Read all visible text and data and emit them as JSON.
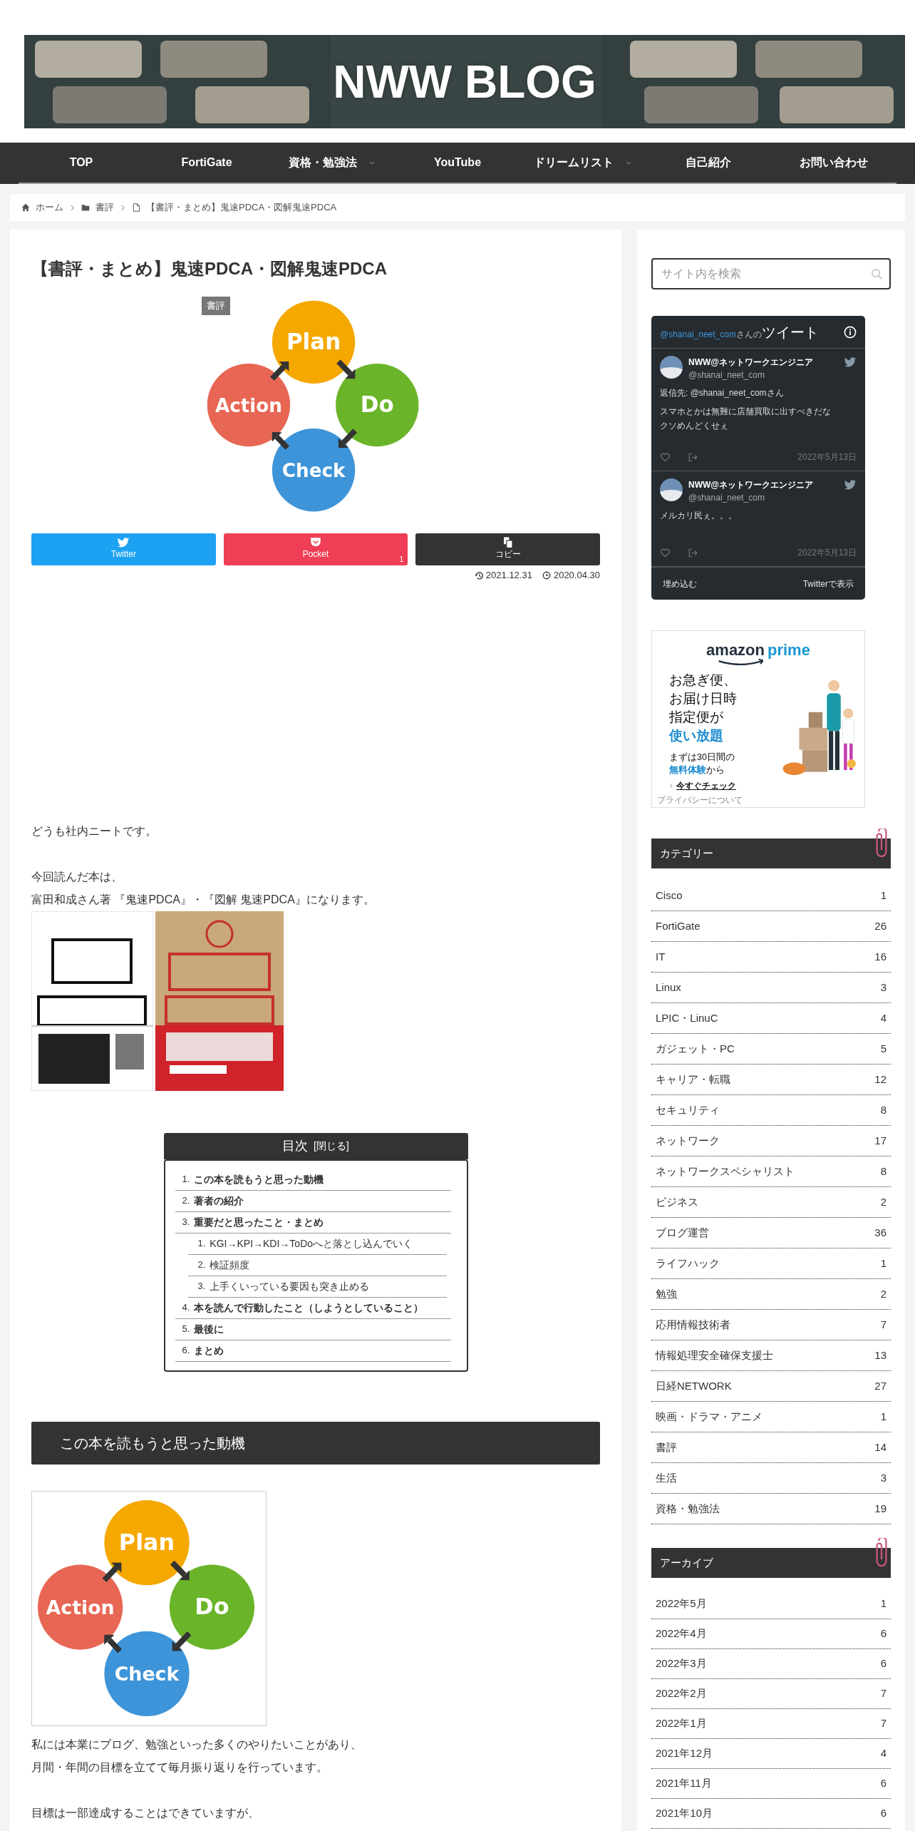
{
  "header": {
    "title": "NWW BLOG"
  },
  "nav": [
    {
      "label": "TOP",
      "submenu": false
    },
    {
      "label": "FortiGate",
      "submenu": false
    },
    {
      "label": "資格・勉強法",
      "submenu": true
    },
    {
      "label": "YouTube",
      "submenu": false
    },
    {
      "label": "ドリームリスト",
      "submenu": true
    },
    {
      "label": "自己紹介",
      "submenu": false
    },
    {
      "label": "お問い合わせ",
      "submenu": false
    }
  ],
  "breadcrumb": [
    {
      "kind": "home",
      "label": "ホーム"
    },
    {
      "kind": "category",
      "label": "書評"
    },
    {
      "kind": "page",
      "label": "【書評・まとめ】鬼速PDCA・図解鬼速PDCA"
    }
  ],
  "article": {
    "title": "【書評・まとめ】鬼速PDCA・図解鬼速PDCA",
    "category_label": "書評",
    "eyecatch": {
      "labels": [
        "Plan",
        "Do",
        "Check",
        "Action"
      ]
    },
    "share_buttons": [
      {
        "kind": "twitter",
        "label": "Twitter"
      },
      {
        "kind": "pocket",
        "label": "Pocket",
        "count": "1"
      },
      {
        "kind": "copy",
        "label": "コピー"
      }
    ],
    "dates": [
      {
        "kind": "updated",
        "text": "2021.12.31"
      },
      {
        "kind": "published",
        "text": "2020.04.30"
      }
    ],
    "blocks": [
      {
        "kind": "paragraph",
        "lines": [
          "どうも社内ニートです。"
        ]
      },
      {
        "kind": "paragraph",
        "lines": [
          "今回読んだ本は、",
          "富田和成さん著 『鬼速PDCA』・『図解 鬼速PDCA』になります。"
        ]
      },
      {
        "kind": "book_covers"
      },
      {
        "kind": "toc",
        "title": "目次",
        "toggle": "[閉じる]",
        "items": [
          {
            "number": "1.",
            "label": "この本を読もうと思った動機"
          },
          {
            "number": "2.",
            "label": "著者の紹介"
          },
          {
            "number": "3.",
            "label": "重要だと思ったこと・まとめ",
            "children": [
              {
                "number": "1.",
                "label": "KGI→KPI→KDI→ToDoへと落とし込んでいく"
              },
              {
                "number": "2.",
                "label": "検証頻度"
              },
              {
                "number": "3.",
                "label": "上手くいっている要因も突き止める"
              }
            ]
          },
          {
            "number": "4.",
            "label": "本を読んで行動したこと（しようとしていること）"
          },
          {
            "number": "5.",
            "label": "最後に"
          },
          {
            "number": "6.",
            "label": "まとめ"
          }
        ]
      },
      {
        "kind": "heading",
        "text": "この本を読もうと思った動機"
      },
      {
        "kind": "pdca",
        "labels": [
          "Plan",
          "Do",
          "Check",
          "Action"
        ]
      },
      {
        "kind": "paragraph",
        "lines": [
          "私には本業にブログ、勉強といった多くのやりたいことがあり、",
          "月間・年間の目標を立てて毎月振り返りを行っています。"
        ]
      },
      {
        "kind": "paragraph",
        "lines": [
          "目標は一部達成することはできていますが、"
        ]
      }
    ]
  },
  "sidebar": {
    "search": {
      "placeholder": "サイト内を検索"
    },
    "twitter": {
      "handle": "@shanai_neet_com",
      "handle_suffix": "さんの",
      "title": "ツイート",
      "tweets": [
        {
          "name": "NWW@ネットワークエンジニア",
          "handle": "@shanai_neet_com",
          "reply_to": "返信先: @shanai_neet_comさん",
          "lines": [
            "スマホとかは無難に店舗買取に出すべきだな",
            "クソめんどくせぇ"
          ],
          "date": "2022年5月13日"
        },
        {
          "name": "NWW@ネットワークエンジニア",
          "handle": "@shanai_neet_com",
          "lines": [
            "メルカリ民ぇ。。。"
          ],
          "date": "2022年5月13日"
        }
      ],
      "footer": [
        "埋め込む",
        "Twitterで表示"
      ]
    },
    "ad": {
      "brand": "amazon",
      "tier": "prime",
      "lines": [
        {
          "kind": "big",
          "parts": [
            {
              "text": "お急ぎ便、",
              "accent": false
            }
          ]
        },
        {
          "kind": "big",
          "parts": [
            {
              "text": "お届け日時",
              "accent": false
            }
          ]
        },
        {
          "kind": "big",
          "parts": [
            {
              "text": "指定便が",
              "accent": false
            }
          ]
        },
        {
          "kind": "big",
          "parts": [
            {
              "text": "使い放題",
              "accent": true
            }
          ]
        },
        {
          "kind": "small",
          "parts": [
            {
              "text": "まずは30日間の",
              "accent": false
            }
          ]
        },
        {
          "kind": "small",
          "parts": [
            {
              "text": "無料体験",
              "accent": true
            },
            {
              "text": "から",
              "accent": false
            }
          ]
        }
      ],
      "cta": "今すぐチェック",
      "privacy": "プライバシーについて"
    },
    "widgets": [
      {
        "title": "カテゴリー",
        "items": [
          {
            "label": "Cisco",
            "count": "1"
          },
          {
            "label": "FortiGate",
            "count": "26"
          },
          {
            "label": "IT",
            "count": "16"
          },
          {
            "label": "Linux",
            "count": "3"
          },
          {
            "label": "LPIC・LinuC",
            "count": "4"
          },
          {
            "label": "ガジェット・PC",
            "count": "5"
          },
          {
            "label": "キャリア・転職",
            "count": "12"
          },
          {
            "label": "セキュリティ",
            "count": "8"
          },
          {
            "label": "ネットワーク",
            "count": "17"
          },
          {
            "label": "ネットワークスペシャリスト",
            "count": "8"
          },
          {
            "label": "ビジネス",
            "count": "2"
          },
          {
            "label": "ブログ運営",
            "count": "36"
          },
          {
            "label": "ライフハック",
            "count": "1"
          },
          {
            "label": "勉強",
            "count": "2"
          },
          {
            "label": "応用情報技術者",
            "count": "7"
          },
          {
            "label": "情報処理安全確保支援士",
            "count": "13"
          },
          {
            "label": "日経NETWORK",
            "count": "27"
          },
          {
            "label": "映画・ドラマ・アニメ",
            "count": "1"
          },
          {
            "label": "書評",
            "count": "14"
          },
          {
            "label": "生活",
            "count": "3"
          },
          {
            "label": "資格・勉強法",
            "count": "19"
          }
        ]
      },
      {
        "title": "アーカイブ",
        "items": [
          {
            "label": "2022年5月",
            "count": "1"
          },
          {
            "label": "2022年4月",
            "count": "6"
          },
          {
            "label": "2022年3月",
            "count": "6"
          },
          {
            "label": "2022年2月",
            "count": "7"
          },
          {
            "label": "2022年1月",
            "count": "7"
          },
          {
            "label": "2021年12月",
            "count": "4"
          },
          {
            "label": "2021年11月",
            "count": "6"
          },
          {
            "label": "2021年10月",
            "count": "6"
          }
        ]
      }
    ]
  }
}
